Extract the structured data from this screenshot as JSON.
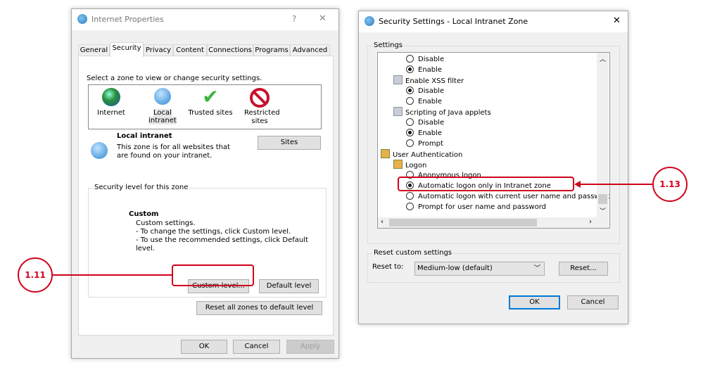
{
  "left_dialog": {
    "title": "Internet Properties",
    "help": "?",
    "close": "✕",
    "tabs": [
      "General",
      "Security",
      "Privacy",
      "Content",
      "Connections",
      "Programs",
      "Advanced"
    ],
    "zone_prompt": "Select a zone to view or change security settings.",
    "zones": [
      "Internet",
      "Local intranet",
      "Trusted sites",
      "Restricted sites"
    ],
    "zone_title": "Local intranet",
    "zone_desc": "This zone is for all websites that are found on your intranet.",
    "sites": "Sites",
    "level_group": "Security level for this zone",
    "level_title": "Custom",
    "level_lines": [
      "Custom settings.",
      "- To change the settings, click Custom level.",
      "- To use the recommended settings, click Default level."
    ],
    "custom_level": "Custom level...",
    "default_level": "Default level",
    "reset_all": "Reset all zones to default level",
    "ok": "OK",
    "cancel": "Cancel",
    "apply": "Apply"
  },
  "right_dialog": {
    "title": "Security Settings - Local Intranet Zone",
    "close": "✕",
    "settings_group": "Settings",
    "items": [
      {
        "type": "radio",
        "label": "Disable",
        "checked": false,
        "indent": 2
      },
      {
        "type": "radio",
        "label": "Enable",
        "checked": true,
        "indent": 2
      },
      {
        "type": "heading",
        "label": "Enable XSS filter",
        "indent": 1
      },
      {
        "type": "radio",
        "label": "Disable",
        "checked": true,
        "indent": 2
      },
      {
        "type": "radio",
        "label": "Enable",
        "checked": false,
        "indent": 2
      },
      {
        "type": "heading",
        "label": "Scripting of Java applets",
        "indent": 1
      },
      {
        "type": "radio",
        "label": "Disable",
        "checked": false,
        "indent": 2
      },
      {
        "type": "radio",
        "label": "Enable",
        "checked": true,
        "indent": 2
      },
      {
        "type": "radio",
        "label": "Prompt",
        "checked": false,
        "indent": 2
      },
      {
        "type": "users",
        "label": "User Authentication",
        "indent": 0
      },
      {
        "type": "users",
        "label": "Logon",
        "indent": 1
      },
      {
        "type": "radio",
        "label": "Anonymous logon",
        "checked": false,
        "indent": 2
      },
      {
        "type": "radio",
        "label": "Automatic logon only in Intranet zone",
        "checked": true,
        "indent": 2
      },
      {
        "type": "radio",
        "label": "Automatic logon with current user name and password",
        "checked": false,
        "indent": 2
      },
      {
        "type": "radio",
        "label": "Prompt for user name and password",
        "checked": false,
        "indent": 2
      }
    ],
    "reset_group": "Reset custom settings",
    "reset_to": "Reset to:",
    "reset_value": "Medium-low (default)",
    "reset_btn": "Reset...",
    "ok": "OK",
    "cancel": "Cancel"
  },
  "callouts": {
    "a": "1.11",
    "b": "1.13"
  },
  "colors": {
    "accent": "#d0021b"
  }
}
